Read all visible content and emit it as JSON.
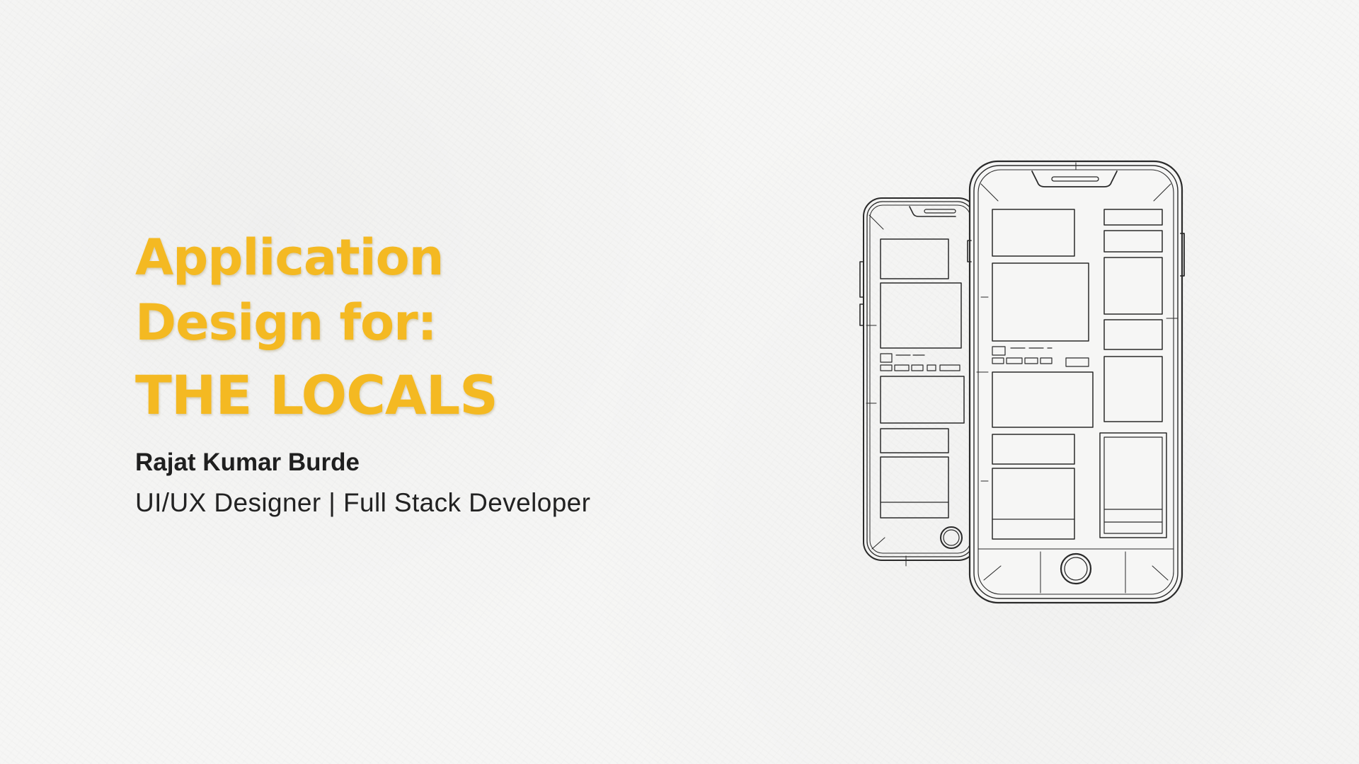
{
  "title": {
    "line1": "Application",
    "line2": "Design for:",
    "project": "THE LOCALS"
  },
  "author": {
    "name": "Rajat Kumar Burde",
    "role": "UI/UX Designer | Full Stack Developer"
  },
  "colors": {
    "accent": "#f4b922",
    "text": "#1f1f1f",
    "background": "#f6f6f5",
    "sketch": "#2a2a2a"
  },
  "illustration": {
    "icon": "phone-wireframe-sketch-icon"
  }
}
